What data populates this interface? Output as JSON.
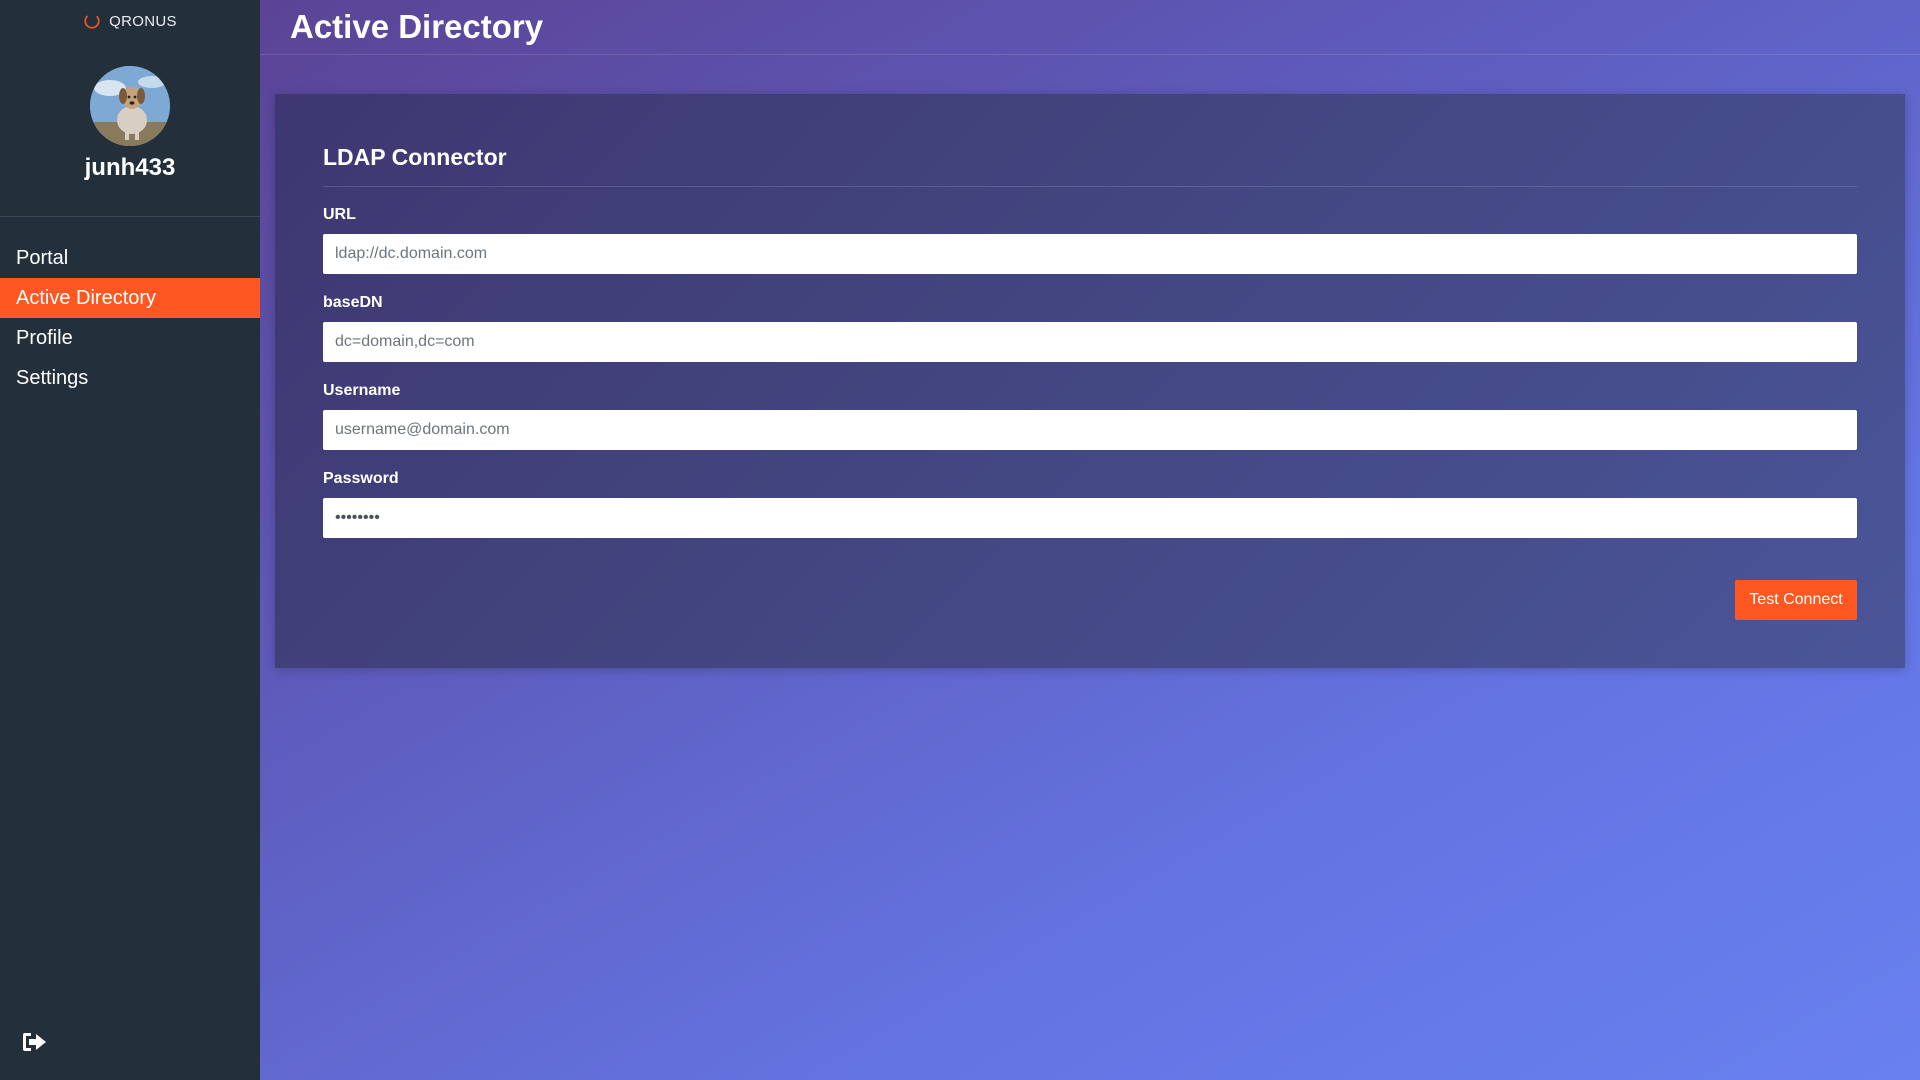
{
  "brand": {
    "name": "QRONUS",
    "icon": "spinner-ring-icon",
    "icon_color": "#e8542a"
  },
  "user": {
    "username": "junh433",
    "avatar": "dog-avatar"
  },
  "sidebar": {
    "items": [
      {
        "label": "Portal",
        "active": false
      },
      {
        "label": "Active Directory",
        "active": true
      },
      {
        "label": "Profile",
        "active": false
      },
      {
        "label": "Settings",
        "active": false
      }
    ],
    "logout_icon": "sign-out-icon"
  },
  "header": {
    "title": "Active Directory"
  },
  "card": {
    "title": "LDAP Connector",
    "fields": {
      "url": {
        "label": "URL",
        "placeholder": "ldap://dc.domain.com",
        "value": ""
      },
      "basedn": {
        "label": "baseDN",
        "placeholder": "dc=domain,dc=com",
        "value": ""
      },
      "username": {
        "label": "Username",
        "placeholder": "username@domain.com",
        "value": ""
      },
      "password": {
        "label": "Password",
        "placeholder": "",
        "value": "password"
      }
    },
    "test_button_label": "Test Connect"
  },
  "colors": {
    "accent": "#ff5722",
    "sidebar_bg": "#232f3a",
    "background_gradient": [
      "#5a3f8d",
      "#6880f0"
    ]
  }
}
